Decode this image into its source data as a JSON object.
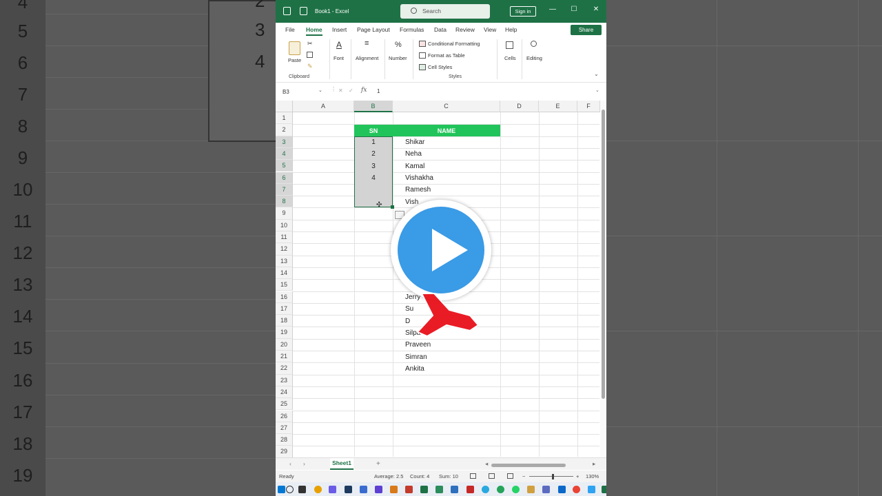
{
  "background": {
    "left_row_numbers": [
      "4",
      "5",
      "6",
      "7",
      "8",
      "9",
      "10",
      "11",
      "12",
      "13",
      "14",
      "15",
      "16",
      "17",
      "18",
      "19"
    ],
    "left_box_numbers": [
      "2",
      "3",
      "4"
    ]
  },
  "titlebar": {
    "title": "Book1 - Excel",
    "search_placeholder": "Search",
    "signin_label": "Sign in",
    "minimize": "—",
    "maximize": "☐",
    "close": "✕"
  },
  "menu": {
    "items": [
      "File",
      "Home",
      "Insert",
      "Page Layout",
      "Formulas",
      "Data",
      "Review",
      "View",
      "Help"
    ],
    "active": "Home",
    "share_label": "Share"
  },
  "ribbon": {
    "clipboard": {
      "paste": "Paste",
      "label": "Clipboard"
    },
    "font": "Font",
    "alignment": "Alignment",
    "number": "Number",
    "styles": {
      "conditional": "Conditional Formatting",
      "format_table": "Format as Table",
      "cell_styles": "Cell Styles",
      "label": "Styles"
    },
    "cells": "Cells",
    "editing": "Editing"
  },
  "formula_bar": {
    "name_box": "B3",
    "fx": "fx",
    "value": "1"
  },
  "grid": {
    "columns": [
      "A",
      "B",
      "C",
      "D",
      "E",
      "F"
    ],
    "selected_column": "B",
    "rows": [
      "1",
      "2",
      "3",
      "4",
      "5",
      "6",
      "7",
      "8",
      "9",
      "10",
      "11",
      "12",
      "13",
      "14",
      "15",
      "16",
      "17",
      "18",
      "19",
      "20",
      "21",
      "22",
      "23",
      "24",
      "25",
      "26",
      "27",
      "28",
      "29"
    ],
    "header": {
      "sn": "SN",
      "name": "NAME"
    },
    "sn_values": [
      "1",
      "2",
      "3",
      "4"
    ],
    "names_top": [
      "Shikar",
      "Neha",
      "Kamal",
      "Vishakha",
      "Ramesh",
      "Vish"
    ],
    "names_bottom": [
      "Jerry",
      "Su",
      "D",
      "Silpa",
      "Praveen",
      "Simran",
      "Ankita"
    ],
    "fill_cursor": "✣"
  },
  "sheets": {
    "tabs": [
      "Sheet1"
    ],
    "add": "+"
  },
  "status": {
    "ready": "Ready",
    "average": "Average: 2.5",
    "count": "Count: 4",
    "sum": "Sum: 10",
    "zoom": "130%"
  },
  "colors": {
    "excel_green": "#1e7145",
    "header_green": "#21c45a",
    "play_blue": "#3a9be6",
    "pointer_red": "#e8101a"
  }
}
